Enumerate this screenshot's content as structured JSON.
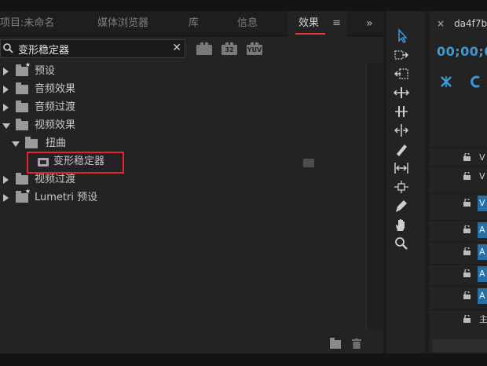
{
  "tabs": [
    {
      "label": "项目:未命名"
    },
    {
      "label": "媒体浏览器"
    },
    {
      "label": "库"
    },
    {
      "label": "信息"
    },
    {
      "label": "效果",
      "menu_glyph": "≡"
    }
  ],
  "overflow_glyph": "»",
  "search": {
    "value": "变形稳定器",
    "clear_glyph": "✕"
  },
  "filter_icons": [
    {
      "label": ""
    },
    {
      "label": "32"
    },
    {
      "label": "YUV"
    }
  ],
  "tree": [
    {
      "label": "预设",
      "icon": "preset-folder-icon",
      "expanded": false
    },
    {
      "label": "音频效果",
      "icon": "folder-icon",
      "expanded": false
    },
    {
      "label": "音频过渡",
      "icon": "folder-icon",
      "expanded": false
    },
    {
      "label": "视频效果",
      "icon": "folder-icon",
      "expanded": true
    },
    {
      "label": "扭曲",
      "icon": "folder-icon",
      "expanded": true
    },
    {
      "label": "变形稳定器",
      "icon": "effect-icon",
      "highlighted": true
    },
    {
      "label": "视频过渡",
      "icon": "folder-icon",
      "expanded": false
    },
    {
      "label": "Lumetri 预设",
      "icon": "preset-folder-icon",
      "expanded": false
    }
  ],
  "timeline": {
    "tab_label": "da4f7b",
    "close_glyph": "×",
    "timecode": "00;00;0",
    "clip_letters": [
      "V",
      "A",
      "A",
      "A",
      "A"
    ],
    "master_label": "主"
  },
  "colors": {
    "accent_underline": "#e03a3a",
    "highlight_box": "#e0262a",
    "timecode_blue": "#3a9ad9",
    "clip_blue": "#2a6fa3"
  }
}
